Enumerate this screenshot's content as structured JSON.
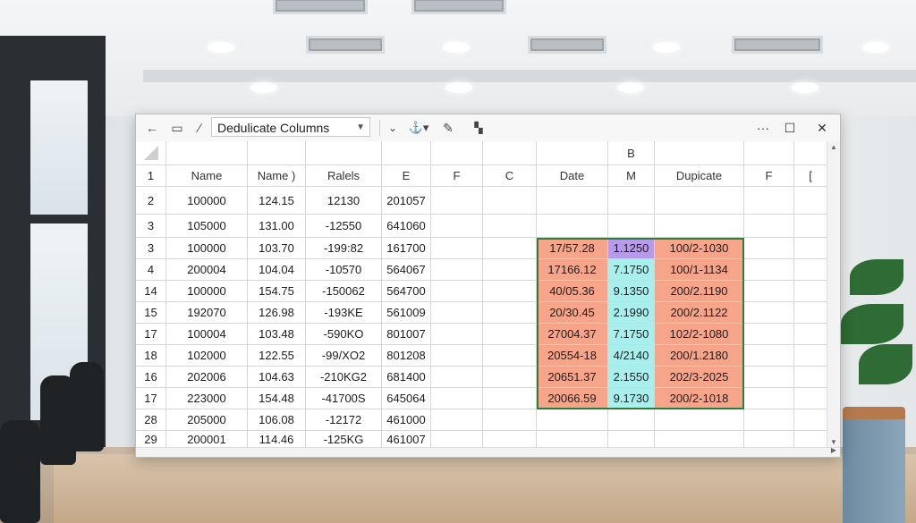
{
  "toolbar": {
    "back_icon": "arrow-left-icon",
    "name_box_value": "Dedulicate Columns",
    "minimize": "···",
    "maximize": "☐",
    "close": "✕"
  },
  "columns": [
    "",
    "Name",
    "Name )",
    "Ralels",
    "E",
    "F",
    "C",
    "Date",
    "M",
    "Dupicate",
    "F",
    "["
  ],
  "header_row_top": [
    "",
    "",
    "",
    "",
    "",
    "",
    "",
    "",
    "B",
    "",
    "",
    ""
  ],
  "rows": [
    {
      "num": "2",
      "a": "100000",
      "b": "124.15",
      "c": "12130",
      "d": "201057",
      "date": "",
      "m": "",
      "dup": ""
    },
    {
      "num": "3",
      "a": "105000",
      "b": "131.00",
      "c": "-12550",
      "d": "641060",
      "date": "",
      "m": "",
      "dup": ""
    },
    {
      "num": "3",
      "a": "100000",
      "b": "103.70",
      "c": "-199:82",
      "d": "161700",
      "date": "17/57.28",
      "m": "1.1250",
      "dup": "100/2-1030"
    },
    {
      "num": "4",
      "a": "200004",
      "b": "104.04",
      "c": "-10570",
      "d": "564067",
      "date": "17166.12",
      "m": "7.1750",
      "dup": "100/1-1134"
    },
    {
      "num": "14",
      "a": "100000",
      "b": "154.75",
      "c": "-150062",
      "d": "564700",
      "date": "40/05.36",
      "m": "9.1350",
      "dup": "200/2.1190"
    },
    {
      "num": "15",
      "a": "192070",
      "b": "126.98",
      "c": "-193KE",
      "d": "561009",
      "date": "20/30.45",
      "m": "2.1990",
      "dup": "200/2.1122"
    },
    {
      "num": "17",
      "a": "100004",
      "b": "103.48",
      "c": "-590KO",
      "d": "801007",
      "date": "27004.37",
      "m": "7.1750",
      "dup": "102/2-1080"
    },
    {
      "num": "18",
      "a": "102000",
      "b": "122.55",
      "c": "-99/XO2",
      "d": "801208",
      "date": "20554-18",
      "m": "4/2140",
      "dup": "200/1.2180"
    },
    {
      "num": "16",
      "a": "202006",
      "b": "104.63",
      "c": "-210KG2",
      "d": "681400",
      "date": "20651.37",
      "m": "2.1550",
      "dup": "202/3-2025"
    },
    {
      "num": "17",
      "a": "223000",
      "b": "154.48",
      "c": "-41700S",
      "d": "645064",
      "date": "20066.59",
      "m": "9.1730",
      "dup": "200/2-1018"
    },
    {
      "num": "28",
      "a": "205000",
      "b": "106.08",
      "c": "-12172",
      "d": "461000",
      "date": "",
      "m": "",
      "dup": ""
    },
    {
      "num": "29",
      "a": "200001",
      "b": "114.46",
      "c": "-125KG",
      "d": "461007",
      "date": "",
      "m": "",
      "dup": ""
    }
  ],
  "header_row_num": "1",
  "colors": {
    "highlight_salmon": "#f6a58a",
    "highlight_cyan": "#a9efee",
    "highlight_purple": "#b79bea",
    "highlight_border": "#2f7d3c"
  }
}
